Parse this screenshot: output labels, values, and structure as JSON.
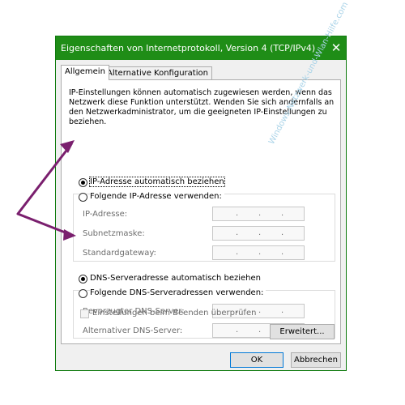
{
  "window": {
    "title": "Eigenschaften von Internetprotokoll, Version 4 (TCP/IPv4)",
    "close_glyph": "✕"
  },
  "tabs": [
    {
      "label": "Allgemein",
      "active": true
    },
    {
      "label": "Alternative Konfiguration",
      "active": false
    }
  ],
  "description": "IP-Einstellungen können automatisch zugewiesen werden, wenn das Netzwerk diese Funktion unterstützt. Wenden Sie sich andernfalls an den Netzwerkadministrator, um die geeigneten IP-Einstellungen zu beziehen.",
  "ip": {
    "auto_label": "IP-Adresse automatisch beziehen",
    "auto_checked": true,
    "manual_label": "Folgende IP-Adresse verwenden:",
    "manual_checked": false,
    "fields": [
      {
        "label": "IP-Adresse:"
      },
      {
        "label": "Subnetzmaske:"
      },
      {
        "label": "Standardgateway:"
      }
    ]
  },
  "dns": {
    "auto_label": "DNS-Serveradresse automatisch beziehen",
    "auto_checked": true,
    "manual_label": "Folgende DNS-Serveradressen verwenden:",
    "manual_checked": false,
    "fields": [
      {
        "label": "Bevorzugter DNS-Server:"
      },
      {
        "label": "Alternativer DNS-Server:"
      }
    ]
  },
  "ip_dots": ".",
  "validate_label": "Einstellungen beim Beenden überprüfen",
  "buttons": {
    "advanced": "Erweitert...",
    "ok": "OK",
    "cancel": "Abbrechen"
  },
  "watermark": "Windows-Netzwerk-und-Wlan-Hilfe.com",
  "colors": {
    "titlebar": "#1f8d17",
    "annotation_arrow": "#7a1f6e"
  }
}
